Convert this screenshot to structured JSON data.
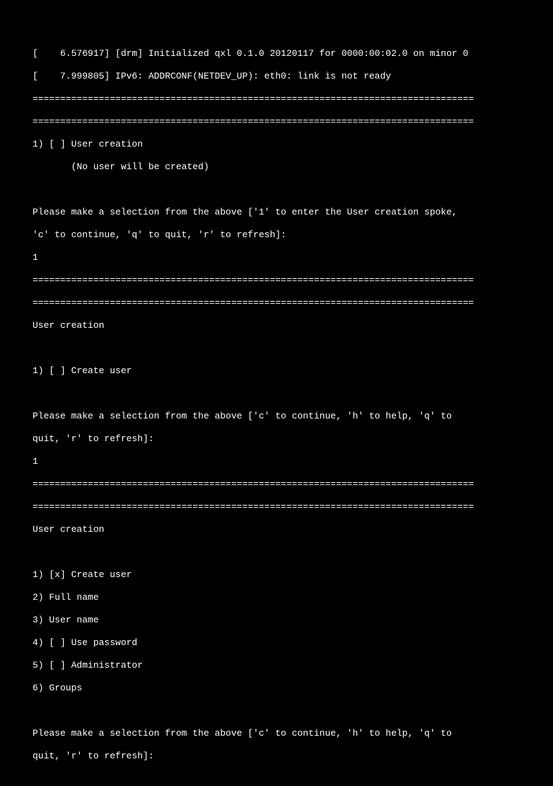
{
  "divider": "================================================================================",
  "boot": {
    "line1": "[    6.576917] [drm] Initialized qxl 0.1.0 20120117 for 0000:00:02.0 on minor 0",
    "line2": "[    7.999805] IPv6: ADDRCONF(NETDEV_UP): eth0: link is not ready"
  },
  "section1": {
    "item1": "1) [ ] User creation",
    "item1_sub": "       (No user will be created)",
    "prompt_l1": "Please make a selection from the above ['1' to enter the User creation spoke,",
    "prompt_l2": "'c' to continue, 'q' to quit, 'r' to refresh]:",
    "input": "1"
  },
  "section2": {
    "title": "User creation",
    "item1": "1) [ ] Create user",
    "prompt_l1": "Please make a selection from the above ['c' to continue, 'h' to help, 'q' to",
    "prompt_l2": "quit, 'r' to refresh]:",
    "input": "1"
  },
  "section3": {
    "title": "User creation",
    "item1": "1) [x] Create user",
    "item2": "2) Full name",
    "item3": "3) User name",
    "item4": "4) [ ] Use password",
    "item5": "5) [ ] Administrator",
    "item6": "6) Groups",
    "prompt_l1": "Please make a selection from the above ['c' to continue, 'h' to help, 'q' to",
    "prompt_l2": "quit, 'r' to refresh]:"
  }
}
